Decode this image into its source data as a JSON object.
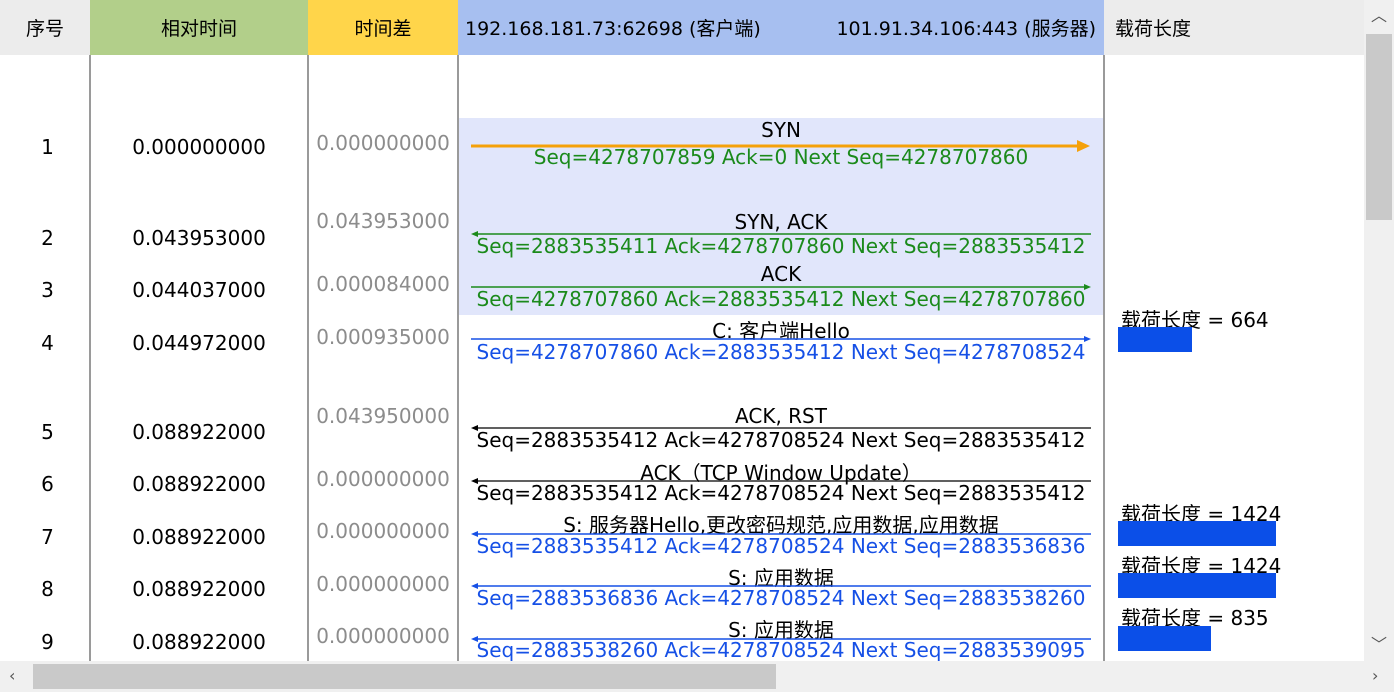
{
  "header": {
    "seq": "序号",
    "rel_time": "相对时间",
    "time_diff": "时间差",
    "client": "192.168.181.73:62698  (客户端)",
    "server": "101.91.34.106:443 (服务器)",
    "payload": "载荷长度"
  },
  "colors": {
    "green": "#1b8a1b",
    "blue": "#1650e6",
    "orange": "#f5a10a",
    "highlight": "#e1e6fb",
    "payload_bar": "#0b4fe8"
  },
  "packets": [
    {
      "no": "1",
      "rel": "0.000000000",
      "diff": "0.000000000",
      "label": "SYN",
      "seq": "Seq=4278707859  Ack=0  Next Seq=4278707860",
      "direction": "client-to-server"
    },
    {
      "no": "2",
      "rel": "0.043953000",
      "diff": "0.043953000",
      "label": "SYN, ACK",
      "seq": "Seq=2883535411   Ack=4278707860   Next Seq=2883535412",
      "direction": "server-to-client"
    },
    {
      "no": "3",
      "rel": "0.044037000",
      "diff": "0.000084000",
      "label": "ACK",
      "seq": "Seq=4278707860   Ack=2883535412   Next Seq=4278707860",
      "direction": "client-to-server"
    },
    {
      "no": "4",
      "rel": "0.044972000",
      "diff": "0.000935000",
      "label": "C: 客户端Hello",
      "seq": "Seq=4278707860   Ack=2883535412   Next Seq=4278708524",
      "direction": "client-to-server",
      "payload": "载荷长度 = 664",
      "payload_fraction": 0.466
    },
    {
      "no": "5",
      "rel": "0.088922000",
      "diff": "0.043950000",
      "label": "ACK, RST",
      "seq": "Seq=2883535412   Ack=4278708524   Next Seq=2883535412",
      "direction": "server-to-client"
    },
    {
      "no": "6",
      "rel": "0.088922000",
      "diff": "0.000000000",
      "label": "ACK（TCP Window Update）",
      "seq": "Seq=2883535412   Ack=4278708524   Next Seq=2883535412",
      "direction": "server-to-client"
    },
    {
      "no": "7",
      "rel": "0.088922000",
      "diff": "0.000000000",
      "label": "S: 服务器Hello,更改密码规范,应用数据,应用数据",
      "seq": "Seq=2883535412   Ack=4278708524   Next Seq=2883536836",
      "direction": "server-to-client",
      "payload": "载荷长度 = 1424",
      "payload_fraction": 1.0
    },
    {
      "no": "8",
      "rel": "0.088922000",
      "diff": "0.000000000",
      "label": "S: 应用数据",
      "seq": "Seq=2883536836   Ack=4278708524   Next Seq=2883538260",
      "direction": "server-to-client",
      "payload": "载荷长度 = 1424",
      "payload_fraction": 1.0
    },
    {
      "no": "9",
      "rel": "0.088922000",
      "diff": "0.000000000",
      "label": "S: 应用数据",
      "seq": "Seq=2883538260   Ack=4278708524   Next Seq=2883539095",
      "direction": "server-to-client",
      "payload": "载荷长度 = 835",
      "payload_fraction": 0.586
    }
  ]
}
